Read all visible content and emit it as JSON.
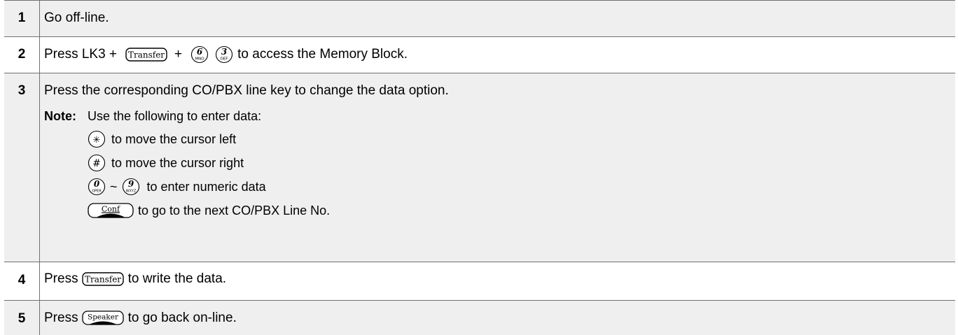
{
  "steps": [
    {
      "num": "1",
      "text": "Go off-line."
    },
    {
      "num": "2",
      "prefix": "Press LK3 +",
      "plus": "+",
      "suffix": "to access the Memory Block.",
      "keys": {
        "transfer": "Transfer",
        "six_num": "6",
        "six_sub": "MNO",
        "three_num": "3",
        "three_sub": "DEF"
      }
    },
    {
      "num": "3",
      "text": "Press the corresponding CO/PBX line key to change the data option.",
      "note_label": "Note:",
      "note_text": "Use the following to enter data:",
      "items": [
        {
          "key": "✳",
          "text": "to move the cursor left"
        },
        {
          "key": "#",
          "text": "to move the cursor right"
        },
        {
          "key_a": "0",
          "key_a_sub": "OPER",
          "tilde": "~",
          "key_b": "9",
          "key_b_sub": "WXYZ",
          "text": "to enter numeric data"
        },
        {
          "key": "Conf",
          "text": "to go to the next CO/PBX Line No."
        }
      ]
    },
    {
      "num": "4",
      "prefix": "Press",
      "key": "Transfer",
      "suffix": "to write the data."
    },
    {
      "num": "5",
      "prefix": "Press",
      "key": "Speaker",
      "suffix": "to go back on-line."
    }
  ]
}
